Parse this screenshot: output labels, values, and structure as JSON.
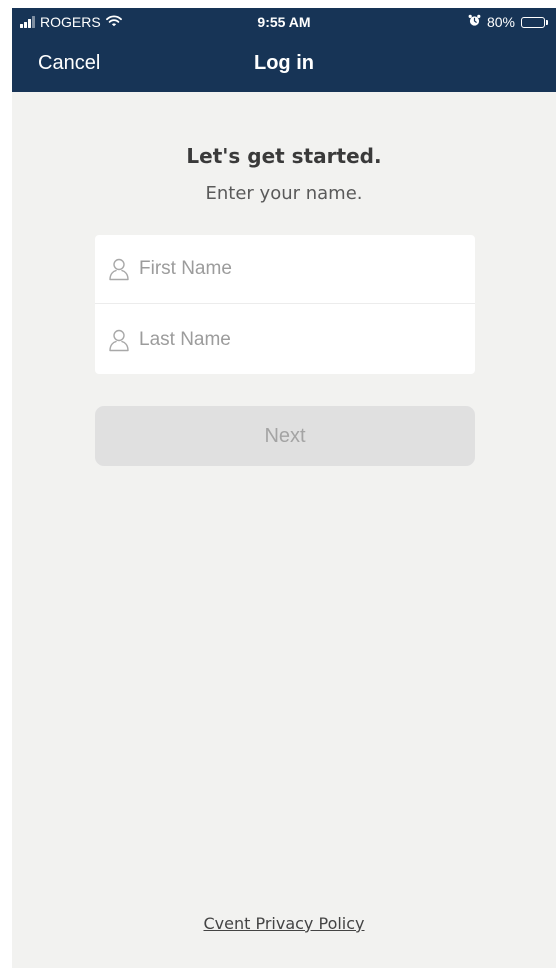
{
  "status_bar": {
    "carrier": "ROGERS",
    "time": "9:55 AM",
    "battery_percent": "80%",
    "battery_level": 0.8,
    "icons": [
      "signal-icon",
      "wifi-icon",
      "alarm-icon",
      "battery-icon"
    ]
  },
  "nav": {
    "cancel_label": "Cancel",
    "title": "Log in"
  },
  "content": {
    "heading": "Let's get started.",
    "subheading": "Enter your name."
  },
  "form": {
    "first_name_placeholder": "First Name",
    "first_name_value": "",
    "last_name_placeholder": "Last Name",
    "last_name_value": "",
    "field_icon": "user-icon"
  },
  "actions": {
    "next_label": "Next"
  },
  "footer": {
    "privacy_label": "Cvent Privacy Policy"
  },
  "colors": {
    "header_background": "#173456",
    "page_background": "#f2f2f0",
    "button_disabled": "#e0e0e0"
  }
}
